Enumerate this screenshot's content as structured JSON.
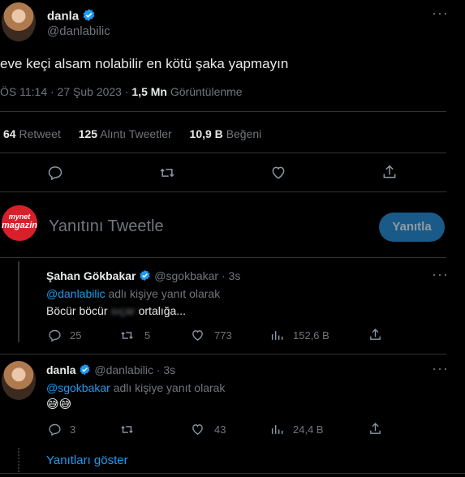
{
  "main_tweet": {
    "author_name": "danla",
    "author_handle": "@danlabilic",
    "text": "eve keçi alsam nolabilir en kötü şaka yapmayın",
    "time": "ÖS 11:14 · 27 Şub 2023 · ",
    "views_count": "1,5 Mn",
    "views_label": "Görüntülenme",
    "retweets_count": "64",
    "retweets_label": "Retweet",
    "quotes_count": "125",
    "quotes_label": "Alıntı Tweetler",
    "likes_count": "10,9 B",
    "likes_label": "Beğeni"
  },
  "composer": {
    "placeholder": "Yanıtını Tweetle",
    "button_label": "Yanıtla",
    "avatar_logo_top": "mynet",
    "avatar_logo_bottom": "magazin"
  },
  "replies": [
    {
      "author_name": "Şahan Gökbakar",
      "author_handle": "@sgokbakar",
      "time": "· 3s",
      "reply_to_handle": "@danlabilic",
      "reply_to_suffix": " adlı kişiye yanıt olarak",
      "text_before": "Böcür böcür ",
      "text_blurred": "sıçar",
      "text_after": " ortalığa...",
      "reply_count": "25",
      "retweet_count": "5",
      "like_count": "773",
      "view_count": "152,6 B"
    },
    {
      "author_name": "danla",
      "author_handle": "@danlabilic",
      "time": "· 3s",
      "reply_to_handle": "@sgokbakar",
      "reply_to_suffix": " adlı kişiye yanıt olarak",
      "text": "😅😅",
      "reply_count": "3",
      "retweet_count": "",
      "like_count": "43",
      "view_count": "24,4 B"
    }
  ],
  "show_replies_label": "Yanıtları göster",
  "more_icon": "more-horizontal-icon",
  "colors": {
    "background": "#000000",
    "accent": "#1d9bf0",
    "muted": "#71767b",
    "divider": "#2f3336"
  }
}
